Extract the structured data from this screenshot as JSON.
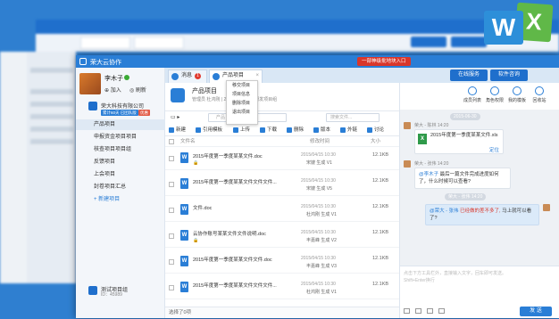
{
  "bg": {
    "title": "荣大云协作"
  },
  "window": {
    "title": "荣大云协作",
    "notice": "一部神级批地块入口"
  },
  "tabs": [
    {
      "label": "消息",
      "badge": "1"
    },
    {
      "label": "产品项目"
    }
  ],
  "top_buttons": {
    "service": "在线服务",
    "software": "软件咨询"
  },
  "user": {
    "name": "李木子",
    "add": "加入",
    "refresh": "刷新"
  },
  "org": {
    "name": "荣大科技有限公司",
    "badge1": "累计60天 已团队版",
    "badge2": "优惠"
  },
  "nav": [
    "产品项目",
    "申报资金项目项目",
    "核查项目项目组",
    "反馈项目",
    "上会项目",
    "封卷项目汇总"
  ],
  "new_project": "+ 新建项目",
  "test_org": {
    "name": "测试项目组",
    "id": "ID：45989"
  },
  "project": {
    "name": "产品项目",
    "sub": "管理员 杜鸿刚 | 20人 | 荣大产品研发项目组"
  },
  "search": {
    "file_placeholder": "产品",
    "search_placeholder": "搜索文件..."
  },
  "toolbar": [
    "新建",
    "引用模板",
    "上传",
    "下载",
    "删除",
    "版本",
    "外链",
    "讨论"
  ],
  "table_header": {
    "name": "文件名",
    "date": "修改时间",
    "size": "大小"
  },
  "files": [
    {
      "name": "2015年度第一季度某某文件.doc",
      "link": "🔒",
      "date": "2015/04/15 10:30",
      "author": "宋嫂",
      "ver": "生成 V1",
      "size": "12.1KB"
    },
    {
      "name": "2015年度第一季度某某文件文件文件...",
      "link": "",
      "date": "2015/04/15 10:30",
      "author": "宋嫂",
      "ver": "生成 V5",
      "size": "12.1KB"
    },
    {
      "name": "文件.doc",
      "link": "",
      "date": "2015/04/15 10:30",
      "author": "杜鸿刚",
      "ver": "生成 V1",
      "size": "12.1KB"
    },
    {
      "name": "云协作账号某某文件文件说明.doc",
      "link": "🔒",
      "date": "2015/04/15 10:30",
      "author": "丰嘉峰",
      "ver": "生成 V2",
      "size": "12.1KB"
    },
    {
      "name": "2015年度第一季度某某文件文件.doc",
      "link": "",
      "date": "2015/04/15 10:30",
      "author": "丰嘉峰",
      "ver": "生成 V3",
      "size": "12.1KB"
    },
    {
      "name": "2015年度第一季度某某文件文件文件...",
      "link": "",
      "date": "2015/04/15 10:30",
      "author": "杜鸿刚",
      "ver": "生成 V1",
      "size": "12.1KB"
    }
  ],
  "status": "选择了0项",
  "chat_header": [
    "成员列表",
    "角色权限",
    "我的模板",
    "回收站"
  ],
  "menu": [
    "移交项目",
    "项目信息",
    "删除项目",
    "退出项目"
  ],
  "chat": {
    "ts1": "2015-06-30",
    "u1": "荣大 - 陈林   14:20",
    "file_msg": "2015年度第一季度某某文件.xls",
    "locate": "定位",
    "u2": "荣大 - 张伟   14:20",
    "m2_at": "@李木子",
    "m2": "最后一篇文件完成进度如何了，什么时候可以查看?",
    "ts2": "荣大 - 张伟   14:20",
    "m3_at": "@荣大 - 张伟",
    "m3_red": "已经做的差不多了,",
    "m3": "马上就可以看了?"
  },
  "input_placeholder": "点击下方工具栏外，直接输入文字，回车即可发送。Shift+Enter换行",
  "send": "发 送"
}
